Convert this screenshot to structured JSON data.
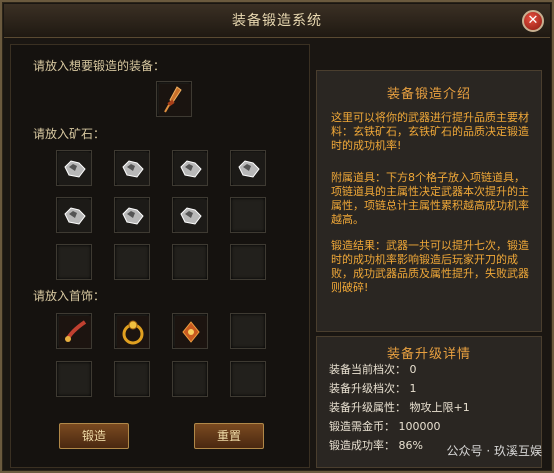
{
  "window": {
    "title": "装备锻造系统",
    "close_icon": "close-icon"
  },
  "left": {
    "equip_label": "请放入想要锻造的装备：",
    "ore_label": "请放入矿石：",
    "jewelry_label": "请放入首饰：",
    "ore_slots_filled": 7,
    "ore_slots_total": 12,
    "jewelry_slots_filled": 3,
    "jewelry_slots_total": 8,
    "forge_button": "锻造",
    "reset_button": "重置"
  },
  "intro": {
    "title": "装备锻造介绍",
    "p1": "这里可以将你的武器进行提升品质主要材料：玄铁矿石，玄铁矿石的品质决定锻造时的成功机率!",
    "p2": "附属道具：下方8个格子放入项链道具，项链道具的主属性决定武器本次提升的主属性，项链总计主属性累积越高成功机率越高。",
    "p3": "锻造结果：武器一共可以提升七次，锻造时的成功机率影响锻造后玩家开刀的成败，成功武器品质及属性提升，失败武器则破碎!"
  },
  "details": {
    "title": "装备升级详情",
    "current_level": "装备当前档次：  0",
    "upgrade_level": "装备升级档次：  1",
    "upgrade_attr": "装备升级属性：  物攻上限+1",
    "gold_cost": "锻造需金币：  100000",
    "success_rate": "锻造成功率：  86%"
  },
  "watermark": "公众号 · 玖溪互娱"
}
